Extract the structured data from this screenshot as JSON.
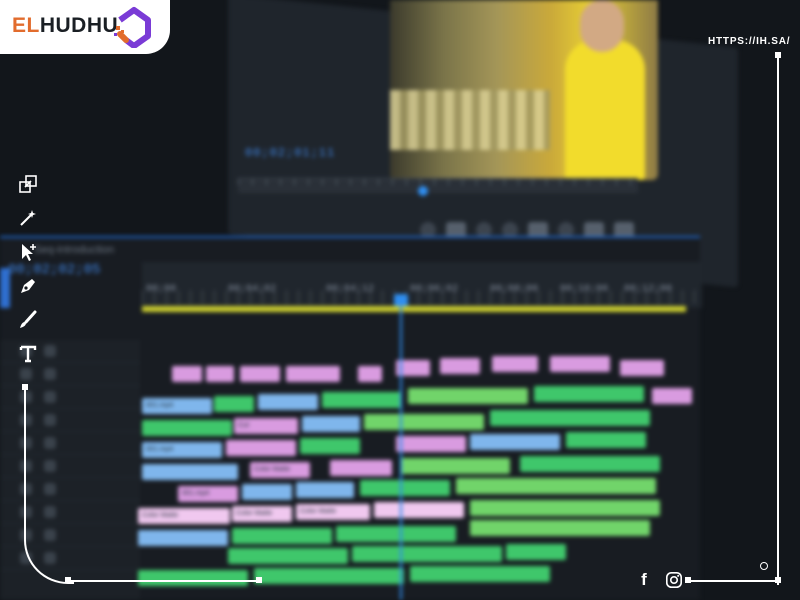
{
  "brand": {
    "logo_prefix": "EL",
    "logo_suffix": "HUDHU",
    "url": "HTTPS://IH.SA/"
  },
  "monitor": {
    "timecode": "00;02;01;11"
  },
  "timeline": {
    "sequence_name": "Seq-introduction",
    "timecode": "00;02;02;05",
    "ruler_labels": [
      "00;00",
      "00;04;02",
      "00;04;12",
      "00;06;02",
      "00;08;00",
      "00;10;00",
      "00;12;00"
    ]
  },
  "clips": {
    "generic_labels": [
      "001.mp4",
      "Cut",
      "001.mp4",
      "Color Matte",
      "001.mp4",
      "Color Matte",
      "Color Matte",
      "Color Matte"
    ]
  },
  "tools": [
    {
      "name": "selection-tool-icon"
    },
    {
      "name": "magic-wand-icon"
    },
    {
      "name": "track-select-icon"
    },
    {
      "name": "pen-tool-icon"
    },
    {
      "name": "brush-icon"
    },
    {
      "name": "type-tool-icon"
    }
  ],
  "social": [
    {
      "name": "facebook-icon",
      "glyph": "f"
    },
    {
      "name": "instagram-icon"
    }
  ],
  "colors": {
    "accent_orange": "#e26c2d",
    "accent_purple": "#7a3bd6",
    "timeline_blue": "#2f8ef0",
    "workarea_yellow": "#c9cc2f",
    "clip_pink": "#d99be0",
    "clip_blue": "#7fb6ec",
    "clip_green": "#3fc76b"
  }
}
